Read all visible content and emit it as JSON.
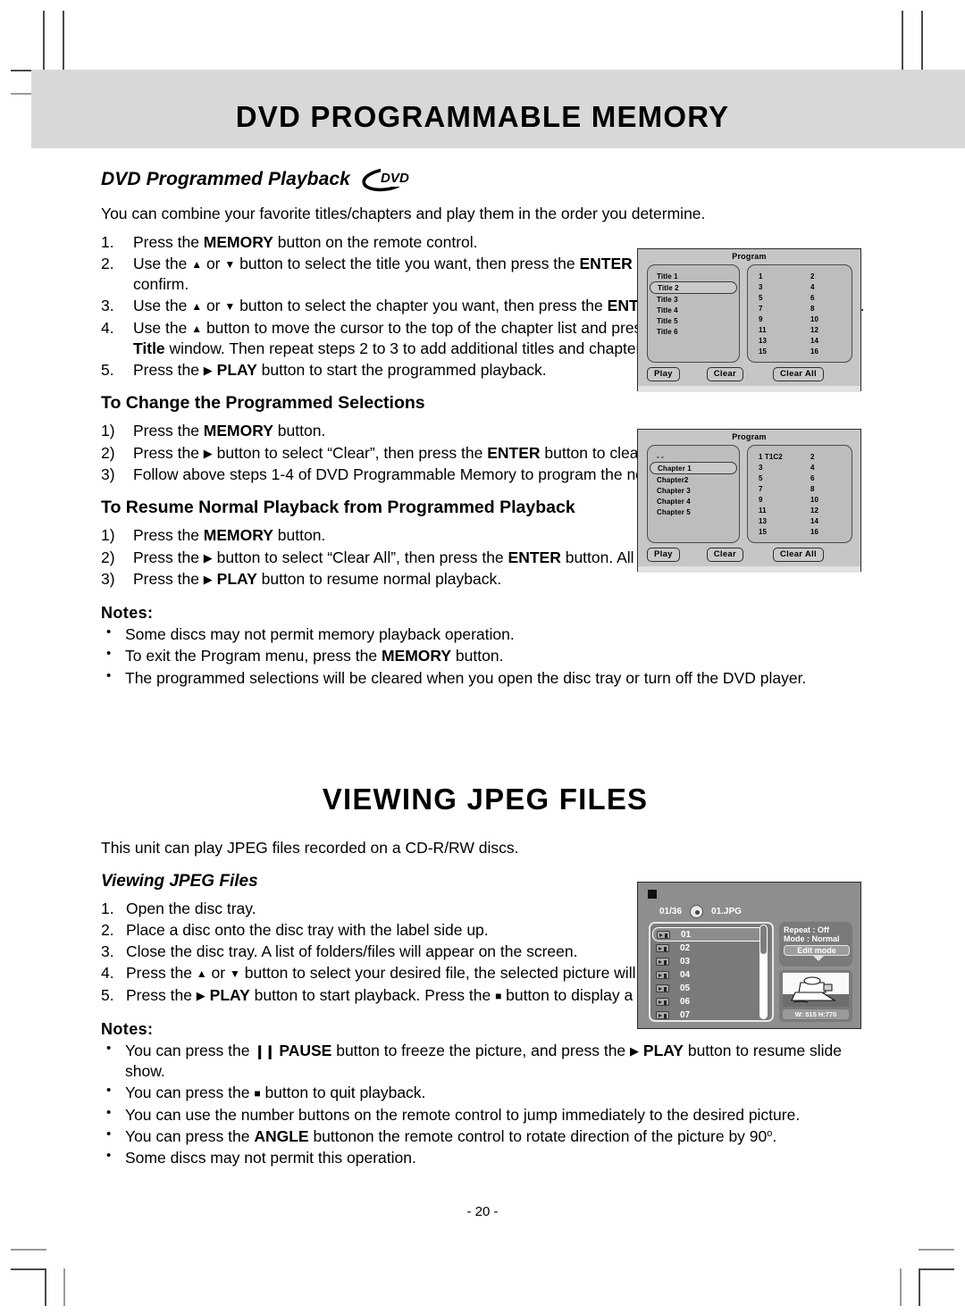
{
  "page": {
    "title1": "DVD PROGRAMMABLE MEMORY",
    "title2": "VIEWING JPEG FILES",
    "page_number": "- 20 -"
  },
  "section1": {
    "heading": "DVD Programmed Playback",
    "logo_text": "DVD",
    "intro": "You can combine your favorite titles/chapters and play them in the order you determine.",
    "steps": [
      {
        "num": "1.",
        "html": "Press the <b>MEMORY</b> button on the remote control."
      },
      {
        "num": "2.",
        "html": "Use the <span class=\"tri-u\">▲</span> or <span class=\"tri-d\">▼</span> button to select the title you want, then press the <b>ENTER</b> button on the remote control to confirm."
      },
      {
        "num": "3.",
        "html": "Use the <span class=\"tri-u\">▲</span> or <span class=\"tri-d\">▼</span> button to select the chapter you want, then press the <b>ENTER</b> button on the remote control."
      },
      {
        "num": "4.",
        "html": "Use the <span class=\"tri-u\">▲</span> button to move the cursor to the top of the chapter list and press the <b>ENTER</b> button to return to <b>Title</b> window. Then repeat steps 2 to 3 to add additional titles and chapters."
      },
      {
        "num": "5.",
        "html": "Press the <span class=\"tri-r\">▶</span> <b>PLAY</b> button to start the programmed playback."
      }
    ]
  },
  "section2": {
    "heading": "To Change the Programmed Selections",
    "steps": [
      {
        "num": "1)",
        "html": "Press the <b>MEMORY</b> button."
      },
      {
        "num": "2)",
        "html": "Press the <span class=\"tri-r\">▶</span> button to select “Clear”, then press the <b>ENTER</b> button to clear them one by one."
      },
      {
        "num": "3)",
        "html": "Follow above steps 1-4 of DVD Programmable Memory to program the new title and chapter."
      }
    ]
  },
  "section3": {
    "heading": "To Resume Normal Playback from Programmed Playback",
    "steps": [
      {
        "num": "1)",
        "html": "Press the <b>MEMORY</b> button."
      },
      {
        "num": "2)",
        "html": "Press the <span class=\"tri-r\">▶</span> button to select “Clear All”, then press the <b>ENTER</b> button. All the programs will be cleared."
      },
      {
        "num": "3)",
        "html": "Press the <span class=\"tri-r\">▶</span> <b>PLAY</b> button to resume normal playback."
      }
    ],
    "notes_label": "Notes:",
    "notes": [
      "Some discs may not permit memory playback operation.",
      "To exit the Program menu, press the <b>MEMORY</b> button.",
      "The programmed selections will be cleared when you open the disc tray or turn off the DVD player."
    ]
  },
  "section4": {
    "intro": "This unit can play JPEG files recorded on a CD-R/RW discs.",
    "heading": "Viewing JPEG Files",
    "steps": [
      {
        "num": "1.",
        "html": "Open the disc tray."
      },
      {
        "num": "2.",
        "html": "Place a disc onto the disc tray with the label side up."
      },
      {
        "num": "3.",
        "html": "Close the disc tray. A list of folders/files will appear on the screen."
      },
      {
        "num": "4.",
        "html": "Press the <span class=\"tri-u\">▲</span> or <span class=\"tri-d\">▼</span> button to select your desired file, the selected picture will appear in the lower right corner."
      },
      {
        "num": "5.",
        "html": "Press the <span class=\"tri-r\">▶</span> <b>PLAY</b> button to start playback. Press the <span class=\"sq\">■</span> button to display a folder list."
      }
    ],
    "notes_label": "Notes:",
    "notes": [
      "You can press the <span class=\"pause-g\">❙❙</span> <b>PAUSE</b> button to freeze the picture, and press the <span class=\"tri-r\">▶</span> <b>PLAY</b> button to resume slide show.",
      "You can press the <span class=\"sq\">■</span> button to quit playback.",
      "You can use the number buttons on the remote control to jump immediately to the desired picture.",
      "You can press the <b>ANGLE</b> buttonon the remote control to rotate direction of the picture by 90<span class=\"sup\">o</span>.",
      "Some discs may not permit this operation."
    ]
  },
  "osd_title_screen": {
    "title": "Program",
    "list": [
      "Title 1",
      "Title 2",
      "Title 3",
      "Title 4",
      "Title 5",
      "Title 6"
    ],
    "selected_index": 1,
    "slots": [
      "1",
      "2",
      "3",
      "4",
      "5",
      "6",
      "7",
      "8",
      "9",
      "10",
      "11",
      "12",
      "13",
      "14",
      "15",
      "16"
    ],
    "buttons": [
      "Play",
      "Clear",
      "Clear All"
    ]
  },
  "osd_chapter_screen": {
    "title": "Program",
    "list": [
      "- -",
      "Chapter 1",
      "Chapter2",
      "Chapter 3",
      "Chapter 4",
      "Chapter 5"
    ],
    "selected_index": 1,
    "slots": [
      "1  T1C2",
      "2",
      "3",
      "4",
      "5",
      "6",
      "7",
      "8",
      "9",
      "10",
      "11",
      "12",
      "13",
      "14",
      "15",
      "16"
    ],
    "buttons": [
      "Play",
      "Clear",
      "Clear All"
    ]
  },
  "osd_jpeg_screen": {
    "counter": "01/36",
    "filename": "01.JPG",
    "files": [
      "01",
      "02",
      "03",
      "04",
      "05",
      "06",
      "07"
    ],
    "selected_index": 0,
    "repeat": "Repeat : Off",
    "mode": "Mode   : Normal",
    "edit_mode": "Edit mode",
    "dimensions": "W: 515  H:770"
  },
  "colors": {
    "header_band": "#d8d8d8",
    "osd_bg": "#c6c6c6",
    "jpeg_osd_bg": "#8e8e8e"
  }
}
